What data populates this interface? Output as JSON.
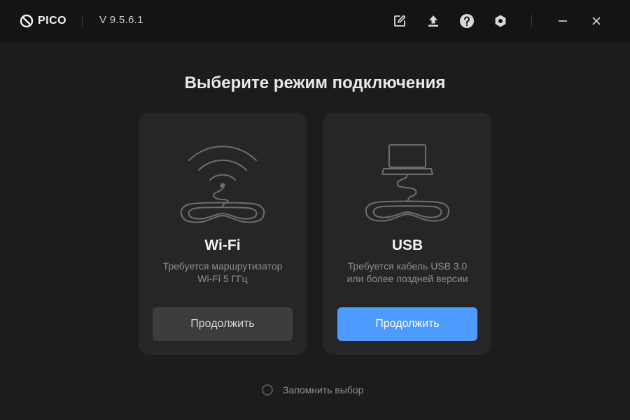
{
  "titlebar": {
    "brand": "PICO",
    "version": "V 9.5.6.1",
    "icons": [
      "edit-icon",
      "upload-icon",
      "help-icon",
      "settings-icon",
      "minimize-icon",
      "close-icon"
    ]
  },
  "main": {
    "heading": "Выберите режим подключения",
    "cards": [
      {
        "id": "wifi",
        "title": "Wi-Fi",
        "desc_line1": "Требуется маршрутизатор",
        "desc_line2": "Wi-Fi 5 ГГц",
        "button": "Продолжить",
        "illustration": "wifi-headset-icon"
      },
      {
        "id": "usb",
        "title": "USB",
        "desc_line1": "Требуется кабель USB 3.0",
        "desc_line2": "или более поздней версии",
        "button": "Продолжить",
        "illustration": "laptop-headset-icon"
      }
    ],
    "remember_label": "Запомнить выбор",
    "remember_checked": false
  },
  "colors": {
    "background": "#1c1c1c",
    "titlebar": "#141414",
    "card": "#262626",
    "primary": "#4d9bff",
    "secondary_button": "#3d3d3d",
    "muted_text": "#8f8f8f"
  }
}
